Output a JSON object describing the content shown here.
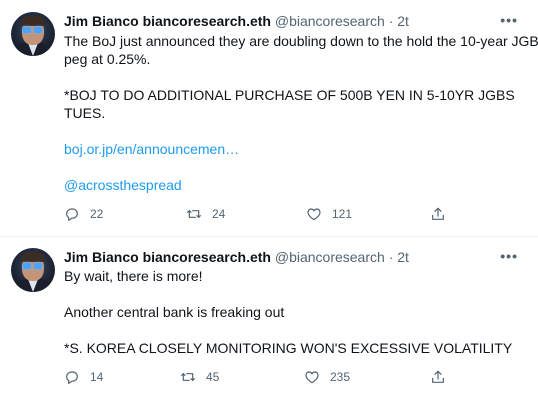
{
  "tweets": [
    {
      "author": {
        "name": "Jim Bianco biancoresearch.eth",
        "handle": "@biancoresearch",
        "time": "2t"
      },
      "lines": [
        "The BoJ just announced they are doubling down to the hold the 10-year JGB",
        "peg at 0.25%.",
        "*BOJ TO DO ADDITIONAL PURCHASE OF 500B YEN IN 5-10YR JGBS",
        "TUES.",
        "boj.or.jp/en/announcemen…",
        "@acrossthespread"
      ],
      "actions": {
        "replies": "22",
        "retweets": "24",
        "likes": "121"
      }
    },
    {
      "author": {
        "name": "Jim Bianco biancoresearch.eth",
        "handle": "@biancoresearch",
        "time": "2t"
      },
      "lines": [
        "By wait, there is more!",
        "Another central bank is freaking out",
        "*S. KOREA CLOSELY MONITORING WON'S EXCESSIVE VOLATILITY"
      ],
      "actions": {
        "replies": "14",
        "retweets": "45",
        "likes": "235"
      }
    }
  ],
  "separator": "·",
  "more_glyph": "•••",
  "colors": {
    "text": "#0f1419",
    "secondary": "#536471",
    "link": "#1d9bf0",
    "divider": "#eff3f4"
  },
  "icons": [
    "reply-icon",
    "retweet-icon",
    "like-icon",
    "share-icon",
    "more-icon"
  ]
}
